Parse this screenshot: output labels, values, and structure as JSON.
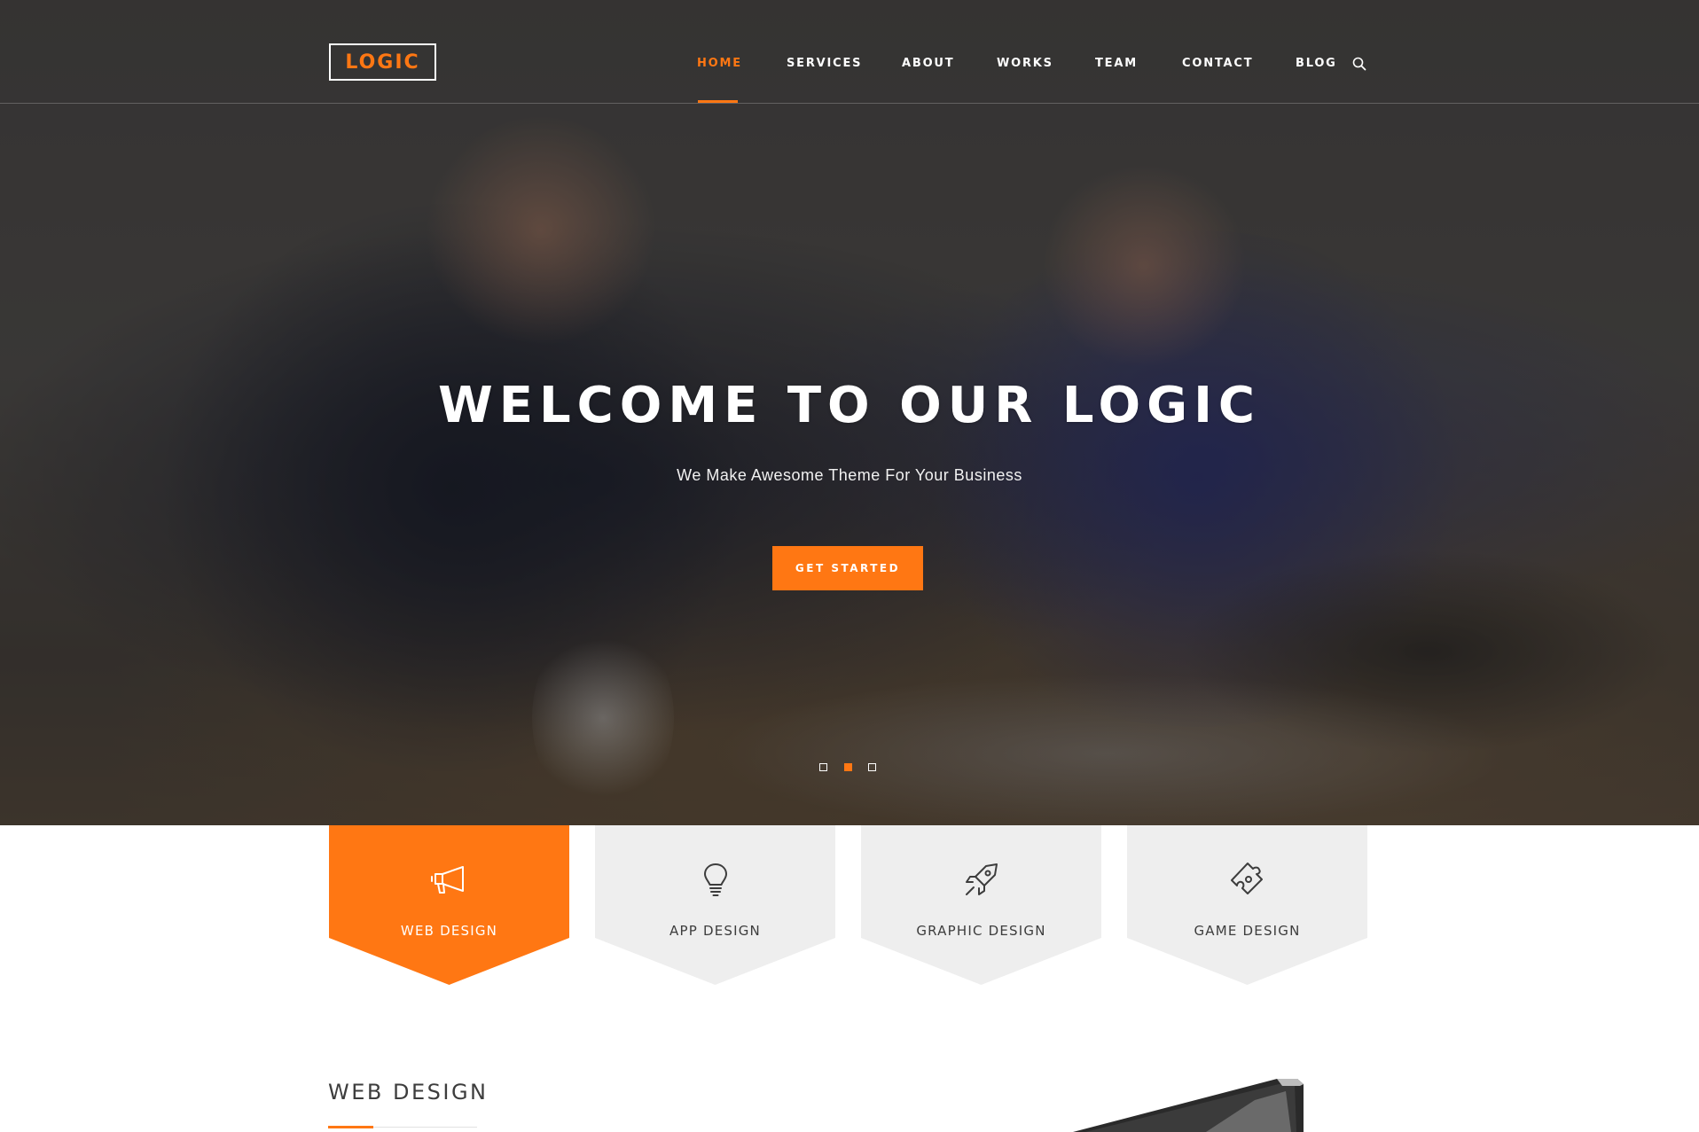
{
  "brand": {
    "logo_text": "LOGIC",
    "accent_color": "#ff7713"
  },
  "nav": {
    "items": [
      {
        "label": "HOME",
        "active": true
      },
      {
        "label": "SERVICES",
        "active": false
      },
      {
        "label": "ABOUT",
        "active": false
      },
      {
        "label": "WORKS",
        "active": false
      },
      {
        "label": "TEAM",
        "active": false
      },
      {
        "label": "CONTACT",
        "active": false
      },
      {
        "label": "BLOG",
        "active": false
      }
    ],
    "search_icon": "search-icon"
  },
  "hero": {
    "title": "WELCOME TO OUR LOGIC",
    "subtitle": "We Make Awesome Theme For Your Business",
    "cta_label": "GET STARTED",
    "slides": {
      "count": 3,
      "active_index": 1
    }
  },
  "services": [
    {
      "label": "WEB DESIGN",
      "icon": "megaphone-icon",
      "active": true
    },
    {
      "label": "APP DESIGN",
      "icon": "lightbulb-icon",
      "active": false
    },
    {
      "label": "GRAPHIC DESIGN",
      "icon": "rocket-icon",
      "active": false
    },
    {
      "label": "GAME DESIGN",
      "icon": "puzzle-icon",
      "active": false
    }
  ],
  "section": {
    "title": "WEB DESIGN"
  },
  "colors": {
    "accent": "#ff7713",
    "tile_bg": "#eeeeee",
    "text_dark": "#3d3d3d"
  }
}
